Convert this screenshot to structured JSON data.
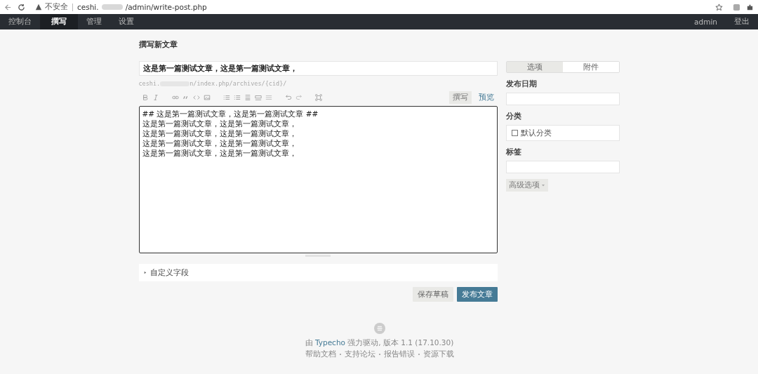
{
  "browser": {
    "security": "不安全",
    "url_host": "ceshi.",
    "url_path": "/admin/write-post.php"
  },
  "nav": {
    "items": [
      {
        "label": "控制台",
        "selected": false
      },
      {
        "label": "撰写",
        "selected": true
      },
      {
        "label": "管理",
        "selected": false
      },
      {
        "label": "设置",
        "selected": false
      }
    ],
    "user": "admin",
    "logout": "登出"
  },
  "page_title": "撰写新文章",
  "post": {
    "title": "这是第一篇测试文章，这是第一篇测试文章，",
    "permalink_host": "ceshi.",
    "permalink_path": "n/index.php/archives/{cid}/",
    "modes": [
      {
        "label": "撰写",
        "selected": true
      },
      {
        "label": "预览",
        "selected": false
      }
    ],
    "content": [
      "## 这是第一篇测试文章，这是第一篇测试文章 ##",
      "这是第一篇测试文章，这是第一篇测试文章，",
      "这是第一篇测试文章，这是第一篇测试文章，",
      "这是第一篇测试文章，这是第一篇测试文章，",
      "这是第一篇测试文章，这是第一篇测试文章，"
    ],
    "custom_fields": "自定义字段"
  },
  "buttons": {
    "save": "保存草稿",
    "publish": "发布文章"
  },
  "sidebar": {
    "tabs": [
      {
        "label": "选项",
        "selected": true
      },
      {
        "label": "附件",
        "selected": false
      }
    ],
    "date_label": "发布日期",
    "category_label": "分类",
    "categories": [
      {
        "label": "默认分类",
        "checked": false
      }
    ],
    "tags_label": "标签",
    "advanced": "高级选项"
  },
  "footer": {
    "powered_prefix": "由",
    "brand": "Typecho",
    "powered_suffix": "强力驱动, 版本 1.1 (17.10.30)",
    "links": [
      "帮助文档",
      "支持论坛",
      "报告错误",
      "资源下载"
    ]
  }
}
